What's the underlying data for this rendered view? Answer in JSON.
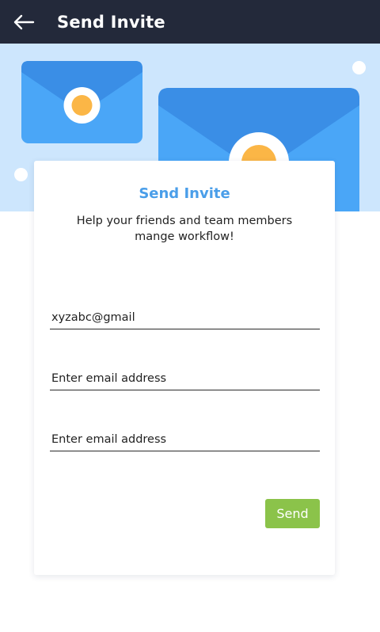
{
  "appbar": {
    "title": "Send Invite",
    "back_icon": "arrow-left-icon",
    "background": "#23293a"
  },
  "hero": {
    "background": "#cde6fd",
    "illustration": "envelope-illustration"
  },
  "card": {
    "title": "Send Invite",
    "subtitle": "Help your friends and team members mange workflow!",
    "title_color": "#4a9ee9"
  },
  "form": {
    "email_1": {
      "value": "xyzabc@gmail",
      "placeholder": "Enter email address"
    },
    "email_2": {
      "value": "",
      "placeholder": "Enter email address"
    },
    "email_3": {
      "value": "",
      "placeholder": "Enter email address"
    },
    "send_label": "Send",
    "send_color": "#8bc34a"
  }
}
